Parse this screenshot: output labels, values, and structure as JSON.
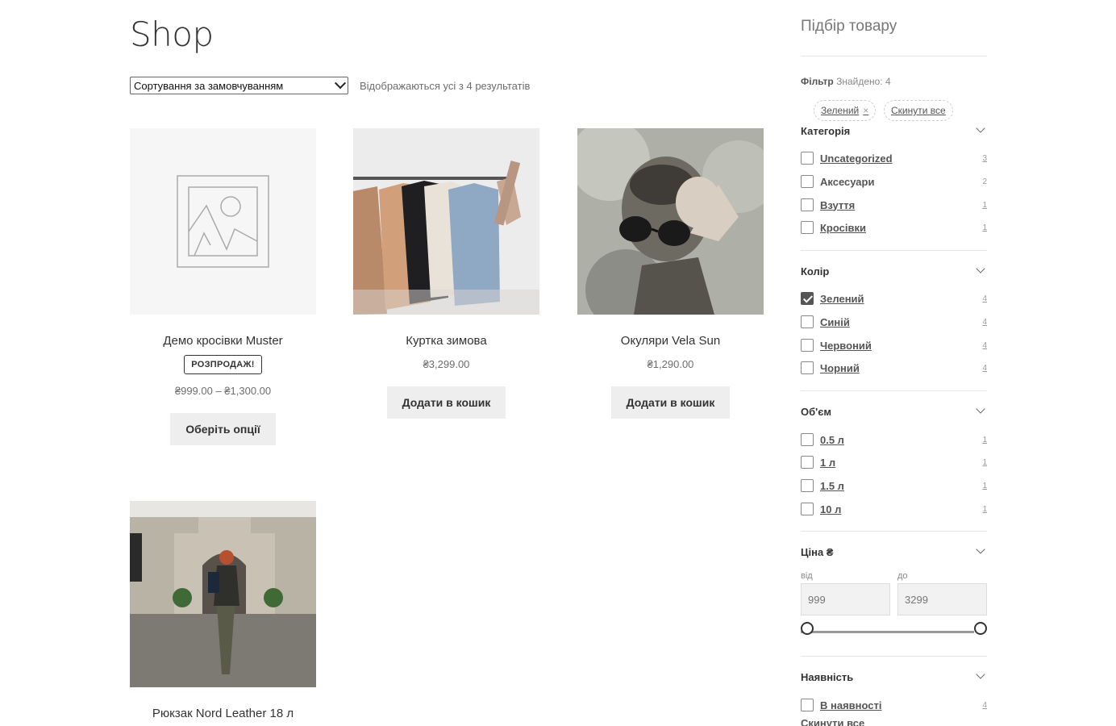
{
  "page": {
    "title": "Shop"
  },
  "toolbar": {
    "sort_selected": "Сортування за замовчуванням",
    "result_count": "Відображаються усі з 4 результатів"
  },
  "products": [
    {
      "title": "Демо кросівки Muster",
      "badge": "РОЗПРОДАЖ!",
      "price": "₴999.00 – ₴1,300.00",
      "button": "Оберіть опції",
      "image": "placeholder-image-icon"
    },
    {
      "title": "Куртка зимова",
      "price": "₴3,299.00",
      "button": "Додати в кошик",
      "image": "jackets-on-rack-photo"
    },
    {
      "title": "Окуляри Vela Sun",
      "price": "₴1,290.00",
      "button": "Додати в кошик",
      "image": "man-holding-sunglasses-photo"
    },
    {
      "title": "Рюкзак Nord Leather 18 л",
      "image": "woman-with-backpack-photo"
    }
  ],
  "sidebar": {
    "title": "Підбір товару",
    "filter_label": "Фільтр",
    "found": "Знайдено: 4",
    "active_chip": "Зелений",
    "reset_chip": "Скинути все",
    "category": {
      "title": "Категорія",
      "items": [
        {
          "label": "Uncategorized",
          "count": "3"
        },
        {
          "label": "Аксесуари",
          "count": "2"
        },
        {
          "label": "Взуття",
          "count": "1"
        },
        {
          "label": "Кросівки",
          "count": "1"
        }
      ]
    },
    "color": {
      "title": "Колір",
      "items": [
        {
          "label": "Зелений",
          "count": "4",
          "checked": true
        },
        {
          "label": "Синій",
          "count": "4"
        },
        {
          "label": "Червоний",
          "count": "4"
        },
        {
          "label": "Чорний",
          "count": "4"
        }
      ]
    },
    "volume": {
      "title": "Об'єм",
      "items": [
        {
          "label": "0.5 л",
          "count": "1"
        },
        {
          "label": "1 л",
          "count": "1"
        },
        {
          "label": "1.5 л",
          "count": "1"
        },
        {
          "label": "10 л",
          "count": "1"
        }
      ]
    },
    "price": {
      "title": "Ціна ₴",
      "from_label": "від",
      "to_label": "до",
      "from_value": "999",
      "to_value": "3299"
    },
    "stock": {
      "title": "Наявність",
      "items": [
        {
          "label": "В наявності",
          "count": "4"
        }
      ]
    },
    "reset_all": "Скинути все"
  },
  "colors": {
    "button_bg": "#eeeeee",
    "text": "#333333",
    "muted": "#6d6d6d"
  }
}
